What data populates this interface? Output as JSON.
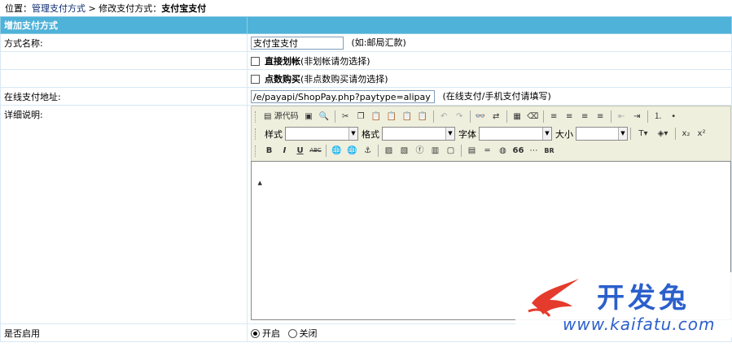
{
  "breadcrumb": {
    "prefix": "位置：",
    "link": "管理支付方式",
    "sep": " > ",
    "current_prefix": "修改支付方式：",
    "current": "支付宝支付"
  },
  "section_title": "增加支付方式",
  "fields": {
    "name_label": "方式名称:",
    "name_value": "支付宝支付",
    "name_hint": "(如:邮局汇款)",
    "direct_label": "直接划帐",
    "direct_hint": "(非划帐请勿选择)",
    "points_label": "点数购买",
    "points_hint": "(非点数购买请勿选择)",
    "url_label": "在线支付地址:",
    "url_value": "/e/payapi/ShopPay.php?paytype=alipay",
    "url_hint": "(在线支付/手机支付请填写)",
    "desc_label": "详细说明:",
    "enable_label": "是否启用",
    "enable_on": "开启",
    "enable_off": "关闭"
  },
  "toolbar": {
    "source_label": "源代码",
    "style_label": "样式",
    "format_label": "格式",
    "font_label": "字体",
    "size_label": "大小",
    "sub_label": "x₂",
    "sup_label": "x²",
    "bold": "B",
    "italic": "I",
    "underline": "U",
    "strike": "ABC",
    "quote": "66",
    "br": "BR"
  },
  "watermark": {
    "brand": "开发兔",
    "url": "www.kaifatu.com"
  },
  "colors": {
    "header_bg": "#4fb2d8",
    "border": "#d9e8f3",
    "toolbar_bg": "#efefde",
    "link": "#0b2a6e",
    "watermark": "#2b5fcc",
    "logo_red": "#e53b2c"
  }
}
